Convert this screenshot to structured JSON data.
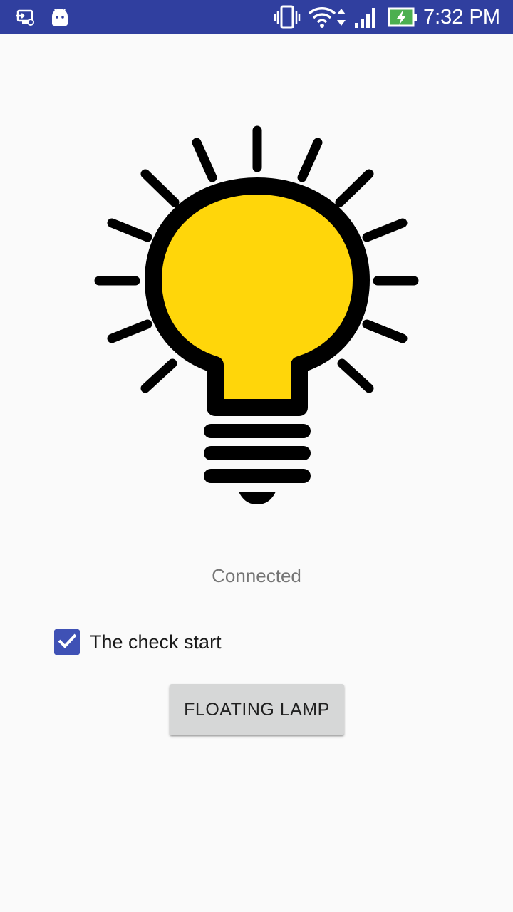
{
  "status_bar": {
    "time": "7:32 PM",
    "background": "#303f9f",
    "icons": [
      "screen-cast-icon",
      "android-icon",
      "vibrate-icon",
      "wifi-icon",
      "data-arrows-icon",
      "signal-icon",
      "battery-charging-icon"
    ]
  },
  "main": {
    "image_icon": "lightbulb-icon",
    "bulb_color": "#ffd60a",
    "status_text": "Connected",
    "checkbox": {
      "label": "The check start",
      "checked": true,
      "color": "#3f51b5"
    },
    "button_label": "FLOATING LAMP"
  }
}
